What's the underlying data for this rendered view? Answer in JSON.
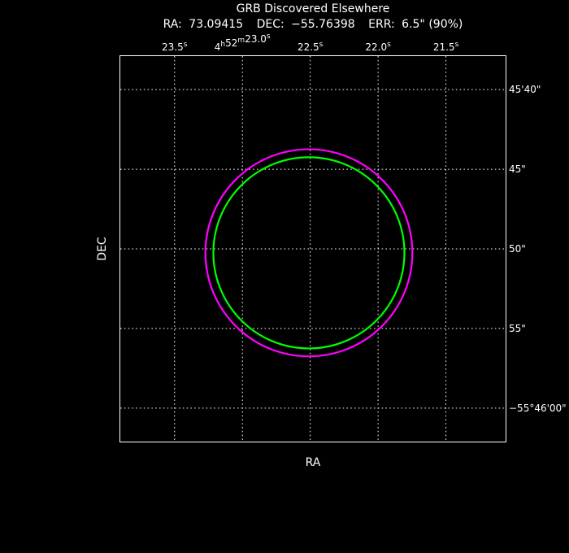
{
  "chart_data": {
    "type": "scatter",
    "title": "GRB Discovered Elsewhere",
    "info": {
      "ra_label": "RA:",
      "ra_value": "73.09415",
      "dec_label": "DEC:",
      "dec_value": "−55.76398",
      "err_label": "ERR:",
      "err_value": "6.5\" (90%)"
    },
    "xlabel": "RA",
    "ylabel": "DEC",
    "xlim_seconds": [
      23.9,
      21.06
    ],
    "ylim_arcsec": [
      37.9,
      62.1
    ],
    "grid": true,
    "x_ticks": [
      {
        "value": 23.5,
        "text": "23.5",
        "sup": "s"
      },
      {
        "value": 23.0,
        "text": "4",
        "sup": "h",
        "text2": "52",
        "sup2": "m",
        "text3": "23.0",
        "sup3": "s"
      },
      {
        "value": 22.5,
        "text": "22.5",
        "sup": "s"
      },
      {
        "value": 22.0,
        "text": "22.0",
        "sup": "s"
      },
      {
        "value": 21.5,
        "text": "21.5",
        "sup": "s"
      }
    ],
    "y_ticks": [
      {
        "value": 40,
        "text": "45'40\""
      },
      {
        "value": 45,
        "text": "45\""
      },
      {
        "value": 50,
        "text": "50\""
      },
      {
        "value": 55,
        "text": "55\""
      },
      {
        "value": 60,
        "text": "−55°46'00\""
      }
    ],
    "circles": [
      {
        "name": "magenta-error-circle",
        "ra_s": 22.51,
        "dec_arcsec": 50.25,
        "radius_arcsec": 6.5,
        "color": "#ff00ff"
      },
      {
        "name": "green-error-circle",
        "ra_s": 22.51,
        "dec_arcsec": 50.25,
        "radius_arcsec": 6.0,
        "color": "#00ff00"
      }
    ]
  },
  "colors": {
    "background": "#000000",
    "foreground": "#ffffff"
  }
}
